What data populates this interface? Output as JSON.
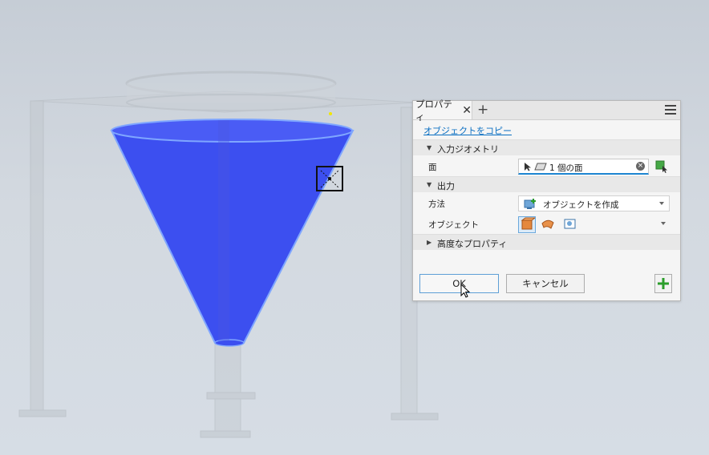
{
  "panel": {
    "tab_label": "プロパティ",
    "tab_close": "✕",
    "tab_add": "+",
    "link_label": "オブジェクトをコピー",
    "sections": {
      "input": {
        "title": "入力ジオメトリ",
        "expanded": true
      },
      "output": {
        "title": "出力",
        "expanded": true
      },
      "advanced": {
        "title": "高度なプロパティ",
        "expanded": false
      }
    },
    "face": {
      "label": "面",
      "value": "1 個の面"
    },
    "method": {
      "label": "方法",
      "value": "オブジェクトを作成"
    },
    "object": {
      "label": "オブジェクト"
    },
    "ok_label": "OK",
    "cancel_label": "キャンセル"
  },
  "colors": {
    "cone_fill": "#3c4ff0",
    "accent": "#1e86d2",
    "link": "#0a6fc2",
    "add_green": "#2a9d2a"
  }
}
